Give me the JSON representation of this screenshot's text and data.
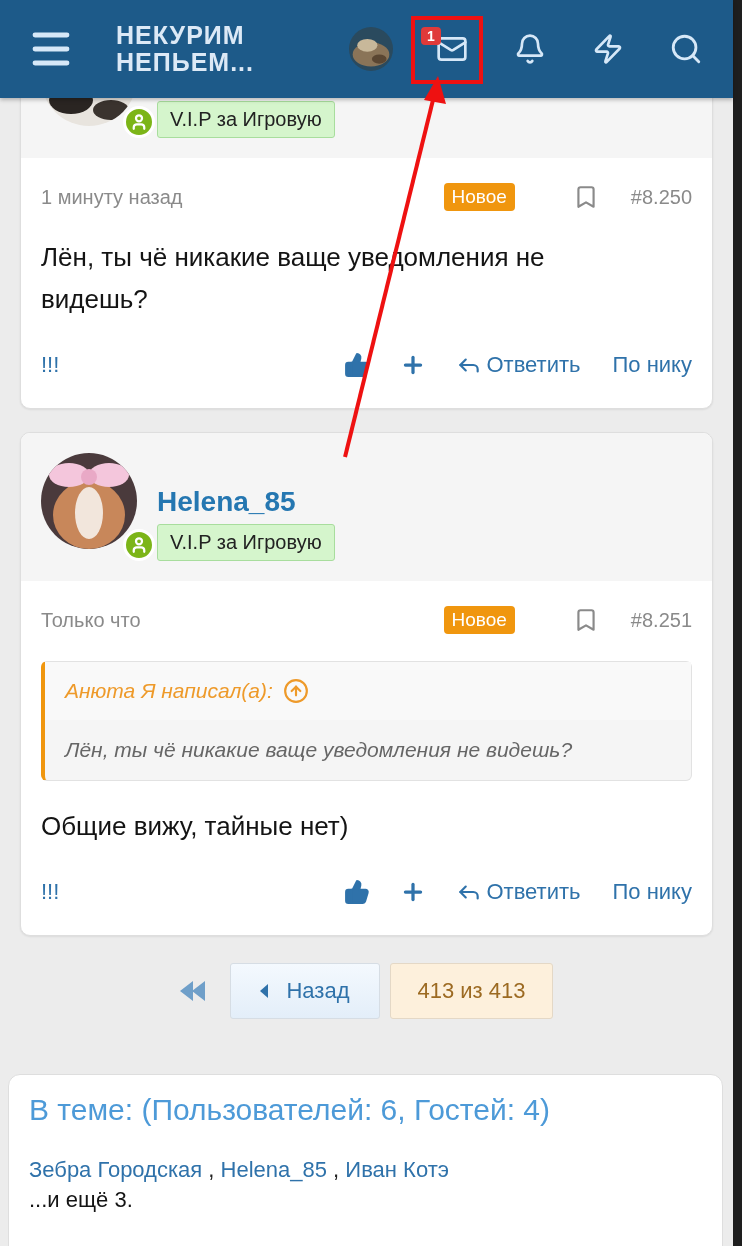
{
  "header": {
    "logo_lines": [
      "НЕКУРИМ",
      "НЕПЬЕМ..."
    ],
    "mail_count": "1"
  },
  "posts": [
    {
      "badge": "V.I.P за Игровую",
      "time": "1 минуту назад",
      "new_label": "Новое",
      "number": "#8.250",
      "message": "Лён, ты чё никакие ваще уведомления не видешь?",
      "reactions": "!!!",
      "reply": "Ответить",
      "by_nick": "По нику"
    },
    {
      "name": "Helena_85",
      "badge": "V.I.P за Игровую",
      "time": "Только что",
      "new_label": "Новое",
      "number": "#8.251",
      "quote": {
        "author": "Анюта Я написал(а):",
        "text": "Лён, ты чё никакие ваще уведомления не видешь?"
      },
      "message": "Общие вижу, тайные нет)",
      "reactions": "!!!",
      "reply": "Ответить",
      "by_nick": "По нику"
    }
  ],
  "pagination": {
    "back": "Назад",
    "current": "413 из 413"
  },
  "online": {
    "title": "В теме: (Пользователей: 6, Гостей: 4)",
    "users": [
      "Зебра Городская",
      "Helena_85",
      "Иван Котэ"
    ],
    "separator": ",",
    "more": "...и ещё 3."
  }
}
